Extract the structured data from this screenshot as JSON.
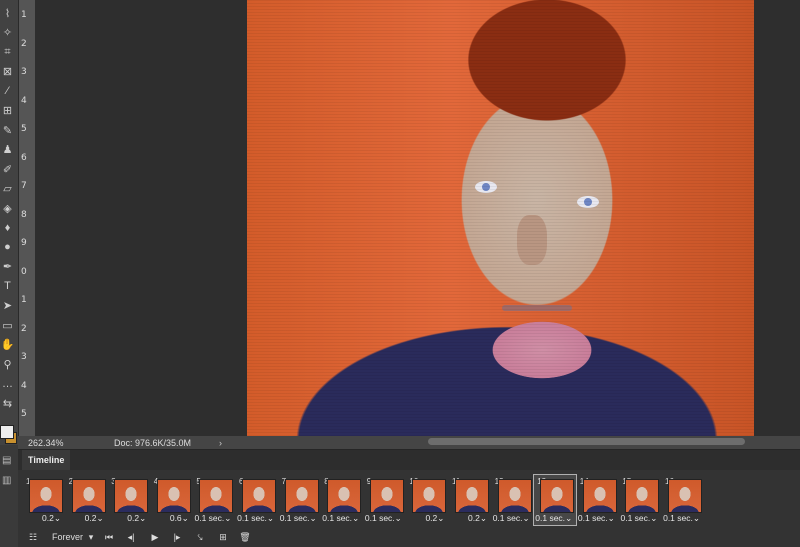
{
  "tools": [
    {
      "icon": "lasso-icon",
      "glyph": "⌇"
    },
    {
      "icon": "magic-wand-icon",
      "glyph": "✧"
    },
    {
      "icon": "crop-icon",
      "glyph": "⌗"
    },
    {
      "icon": "frame-icon",
      "glyph": "⊠"
    },
    {
      "icon": "eyedropper-icon",
      "glyph": "⁄"
    },
    {
      "icon": "healing-brush-icon",
      "glyph": "⊞"
    },
    {
      "icon": "brush-icon",
      "glyph": "✎"
    },
    {
      "icon": "stamp-icon",
      "glyph": "♟"
    },
    {
      "icon": "history-brush-icon",
      "glyph": "✐"
    },
    {
      "icon": "eraser-icon",
      "glyph": "▱"
    },
    {
      "icon": "paint-bucket-icon",
      "glyph": "◈"
    },
    {
      "icon": "blur-icon",
      "glyph": "♦"
    },
    {
      "icon": "dodge-icon",
      "glyph": "●"
    },
    {
      "icon": "pen-icon",
      "glyph": "✒"
    },
    {
      "icon": "type-icon",
      "glyph": "T"
    },
    {
      "icon": "path-selection-icon",
      "glyph": "➤"
    },
    {
      "icon": "rectangle-icon",
      "glyph": "▭"
    },
    {
      "icon": "hand-icon",
      "glyph": "✋"
    },
    {
      "icon": "zoom-icon",
      "glyph": "⚲"
    },
    {
      "icon": "more-tools-icon",
      "glyph": "…"
    },
    {
      "icon": "swap-colors-icon",
      "glyph": "⇆"
    }
  ],
  "ruler": [
    "1",
    "2",
    "3",
    "4",
    "5",
    "6",
    "7",
    "8",
    "9",
    "0",
    "1",
    "2",
    "3",
    "4",
    "5"
  ],
  "status": {
    "zoom": "262.34%",
    "doc": "Doc: 976.6K/35.0M",
    "arrow": "›"
  },
  "panel": {
    "tab": "Timeline"
  },
  "frames": [
    {
      "num": "1",
      "delay": "0.2"
    },
    {
      "num": "2",
      "delay": "0.2"
    },
    {
      "num": "3",
      "delay": "0.2"
    },
    {
      "num": "4",
      "delay": "0.6"
    },
    {
      "num": "5",
      "delay": "0.1 sec."
    },
    {
      "num": "6",
      "delay": "0.1 sec."
    },
    {
      "num": "7",
      "delay": "0.1 sec."
    },
    {
      "num": "8",
      "delay": "0.1 sec."
    },
    {
      "num": "9",
      "delay": "0.1 sec."
    },
    {
      "num": "10",
      "delay": "0.2"
    },
    {
      "num": "11",
      "delay": "0.2"
    },
    {
      "num": "12",
      "delay": "0.1 sec."
    },
    {
      "num": "13",
      "delay": "0.1 sec."
    },
    {
      "num": "14",
      "delay": "0.1 sec."
    },
    {
      "num": "15",
      "delay": "0.1 sec."
    },
    {
      "num": "16",
      "delay": "0.1 sec."
    }
  ],
  "selected_frame": "13",
  "controls": {
    "convert": "☷",
    "loop": "Forever",
    "loop_arrow": "▾",
    "first": "⏮",
    "prev": "◂|",
    "play": "▶",
    "next": "|▸",
    "tween": "⤥",
    "duplicate": "⊞",
    "delete": "🗑"
  },
  "colors": {
    "foreground": "#eeeeee",
    "background": "#c8902e"
  }
}
